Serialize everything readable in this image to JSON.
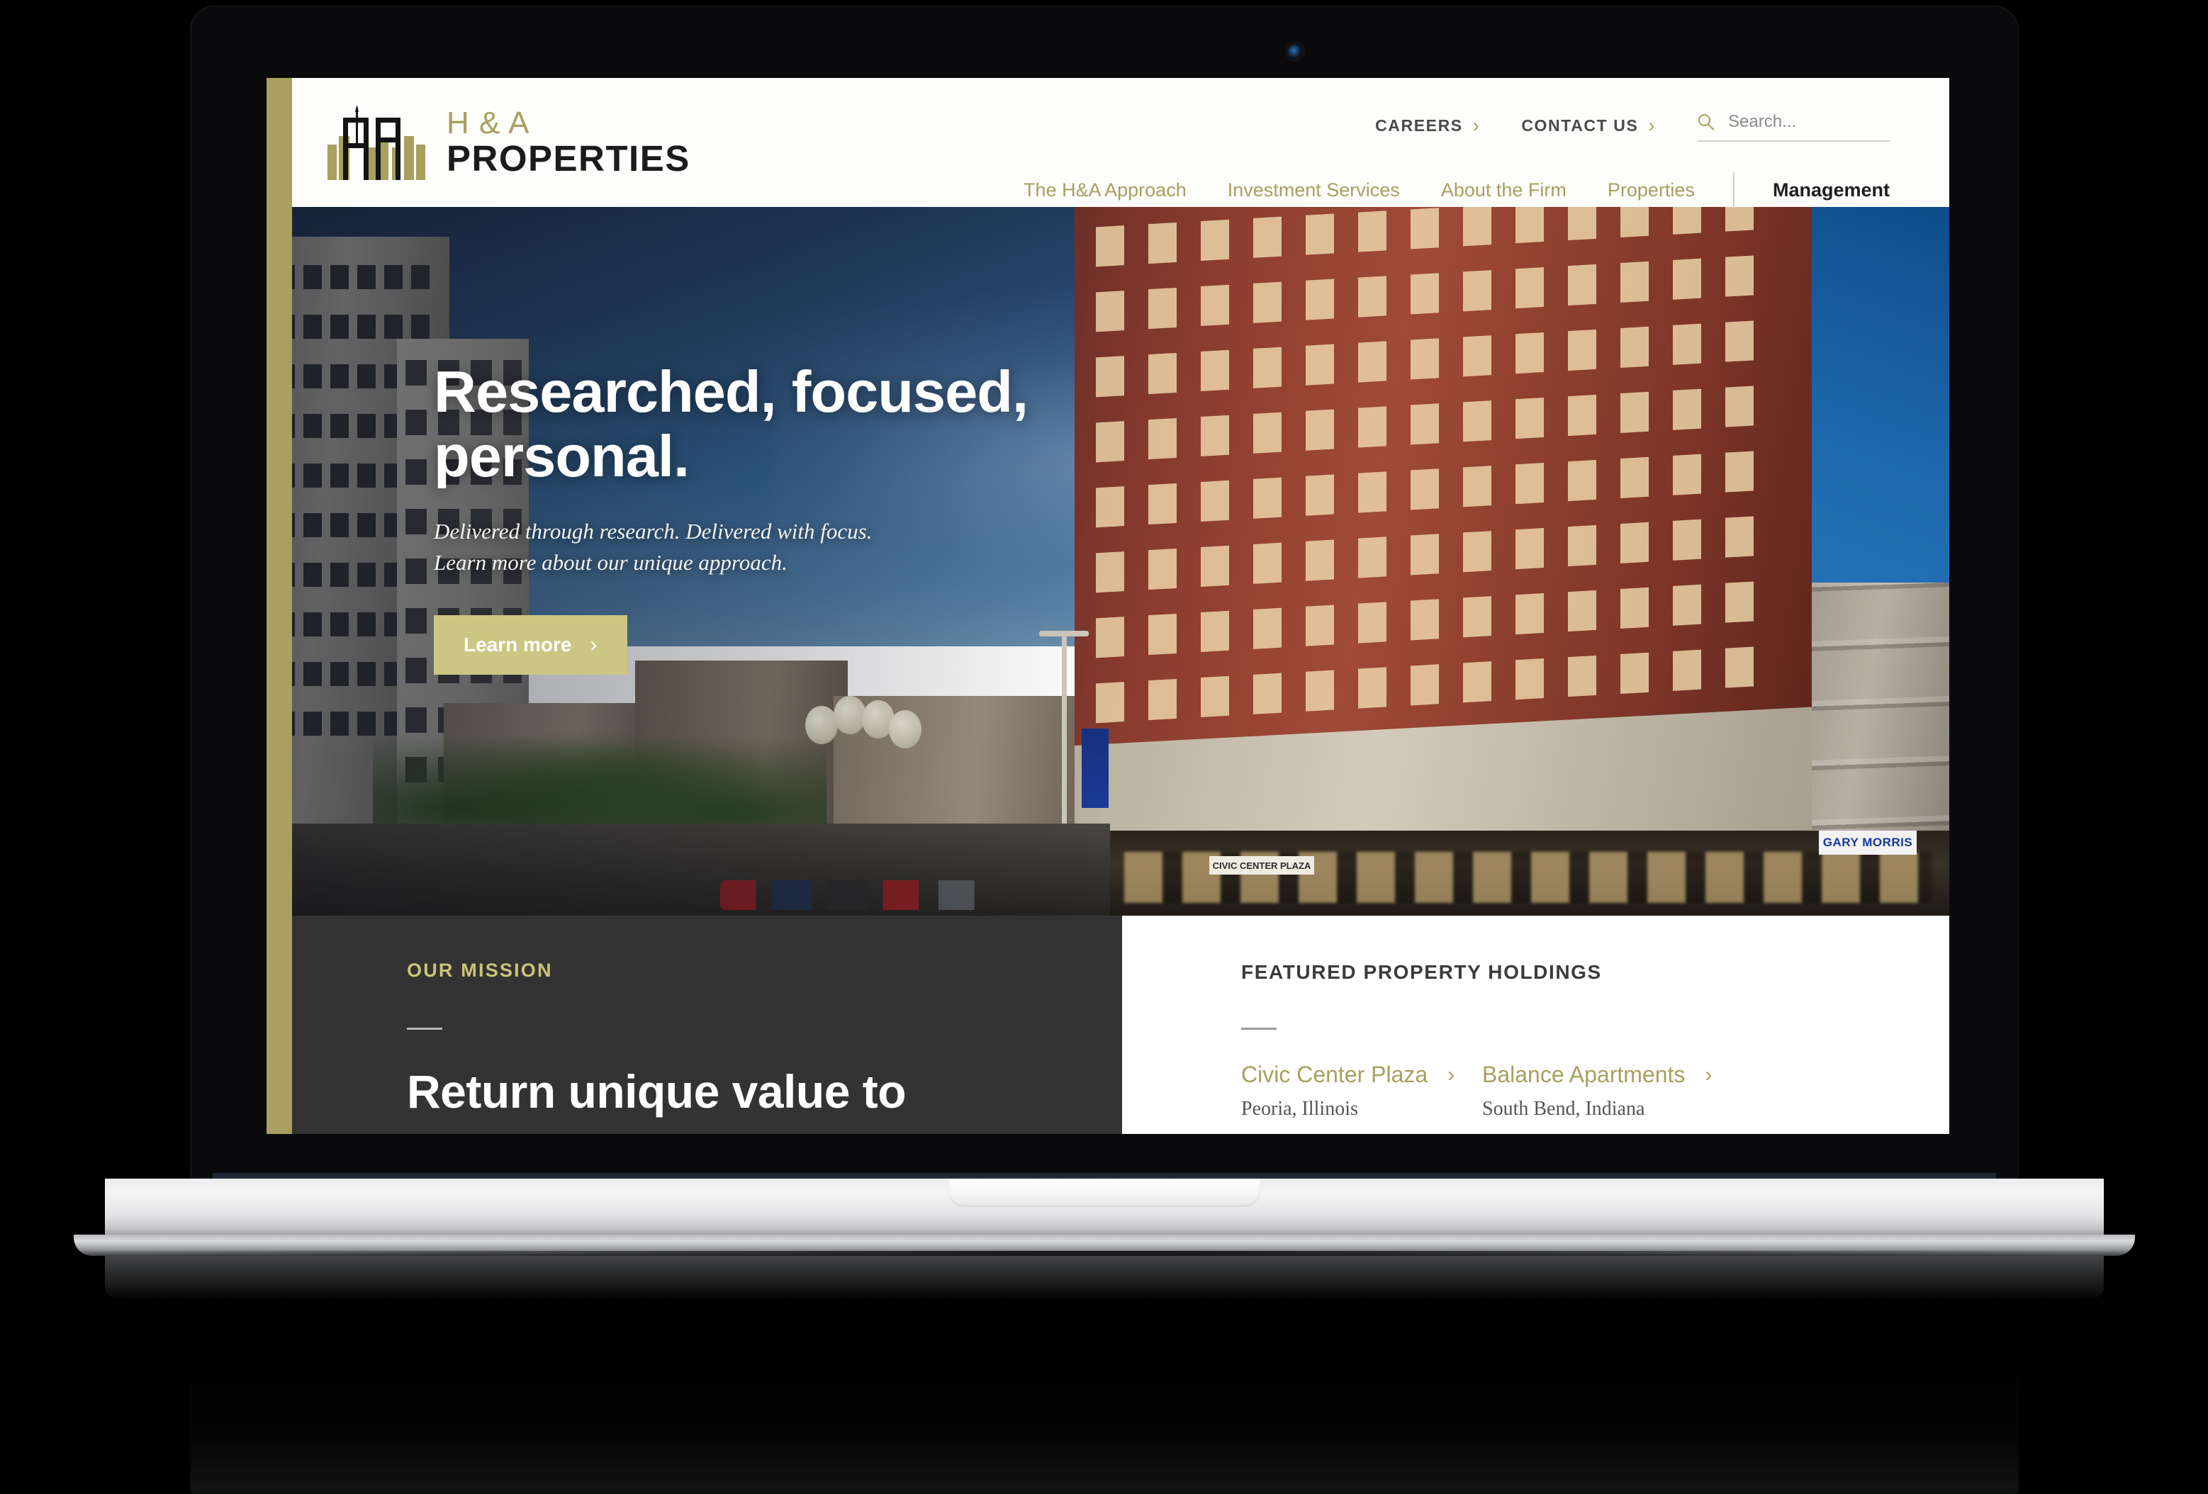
{
  "brand": {
    "logo_line1": "H & A",
    "logo_line2": "PROPERTIES",
    "logo_icon": "skyline-hna-monogram-logo",
    "accent_gold": "#a99f5e",
    "cta_gold": "#ccc684",
    "dark_panel": "#333333"
  },
  "header": {
    "utility_links": [
      {
        "label": "Careers",
        "chevron": "›",
        "icon": "chevron-right-icon"
      },
      {
        "label": "Contact Us",
        "chevron": "›",
        "icon": "chevron-right-icon"
      }
    ],
    "search": {
      "placeholder": "Search...",
      "value": "",
      "icon": "search-icon"
    },
    "nav_items": [
      {
        "label": "The H&A Approach",
        "active": false
      },
      {
        "label": "Investment Services",
        "active": false
      },
      {
        "label": "About the Firm",
        "active": false
      },
      {
        "label": "Properties",
        "active": false
      }
    ],
    "nav_active": {
      "label": "Management",
      "active": true
    }
  },
  "hero": {
    "title": "Researched, focused, personal.",
    "title_line1": "Researched, focused,",
    "title_line2": "personal.",
    "subtitle": "Delivered through research. Delivered with focus. Learn more about our unique approach.",
    "cta_label": "Learn more",
    "cta_chevron": "›",
    "cta_icon": "chevron-right-icon",
    "image_alt": "Downtown brick office building at dusk — Civic Center Plaza",
    "photo_signs": {
      "street_sign": "GARY MORRIS",
      "plaza_sign": "CIVIC CENTER PLAZA"
    }
  },
  "mission": {
    "eyebrow": "OUR MISSION",
    "heading": "Return unique value to"
  },
  "featured": {
    "title": "FEATURED PROPERTY HOLDINGS",
    "properties": [
      {
        "name": "Civic Center Plaza",
        "location": "Peoria, Illinois",
        "chevron": "›",
        "icon": "chevron-right-icon"
      },
      {
        "name": "Balance Apartments",
        "location": "South Bend, Indiana",
        "chevron": "›",
        "icon": "chevron-right-icon"
      }
    ]
  },
  "device": {
    "type": "laptop-mockup",
    "webcam": "webcam-lens"
  }
}
